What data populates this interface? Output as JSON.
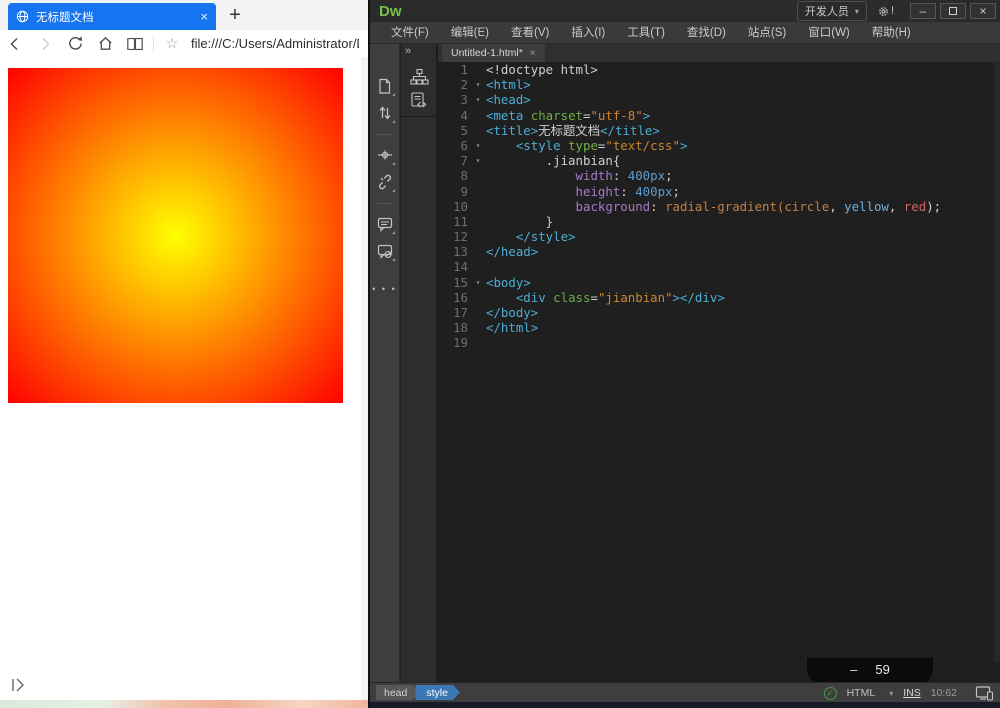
{
  "colors": {
    "browser_tab_blue": "#1574f0",
    "gradient_center": "#ffff00",
    "gradient_edge": "#ff0000",
    "dw_logo_green": "#7cc04b",
    "style_chip_blue": "#3b78b5",
    "check_green": "#43a047"
  },
  "icons": {
    "fold": "▾",
    "caret_down": "▾",
    "check": "✓",
    "star": "☆",
    "ellipsis": "• • •",
    "panel_chevrons": "»"
  },
  "browser": {
    "tab_title": "无标题文档",
    "tab_close": "×",
    "new_tab": "+",
    "address": "file:///C:/Users/Administrator/D"
  },
  "dw": {
    "logo": "Dw",
    "workspace_button": "开发人员",
    "gear_badge": "!",
    "win_minimize": "–",
    "win_close": "×",
    "menus": [
      "文件(F)",
      "编辑(E)",
      "查看(V)",
      "插入(I)",
      "工具(T)",
      "查找(D)",
      "站点(S)",
      "窗口(W)",
      "帮助(H)"
    ],
    "doc_tab": "Untitled-1.html*",
    "doc_tab_close": "×",
    "overlay_fragment_dash": "–",
    "overlay_fragment_text": "59",
    "code_lines": [
      {
        "n": "1",
        "fold": false,
        "seg": [
          {
            "t": "<!doctype html>",
            "c": "plain"
          }
        ]
      },
      {
        "n": "2",
        "fold": true,
        "seg": [
          {
            "t": "<html>",
            "c": "tag"
          }
        ]
      },
      {
        "n": "3",
        "fold": true,
        "seg": [
          {
            "t": "<head>",
            "c": "tag"
          }
        ]
      },
      {
        "n": "4",
        "fold": false,
        "seg": [
          {
            "t": "<meta ",
            "c": "tag"
          },
          {
            "t": "charset",
            "c": "attr"
          },
          {
            "t": "=",
            "c": "plain"
          },
          {
            "t": "\"utf-8\"",
            "c": "string"
          },
          {
            "t": ">",
            "c": "tag"
          }
        ]
      },
      {
        "n": "5",
        "fold": false,
        "seg": [
          {
            "t": "<title>",
            "c": "tag"
          },
          {
            "t": "无标题文档",
            "c": "plain"
          },
          {
            "t": "</title>",
            "c": "tag"
          }
        ]
      },
      {
        "n": "6",
        "fold": true,
        "seg": [
          {
            "t": "    ",
            "c": "plain"
          },
          {
            "t": "<style ",
            "c": "tag"
          },
          {
            "t": "type",
            "c": "attr"
          },
          {
            "t": "=",
            "c": "plain"
          },
          {
            "t": "\"text/css\"",
            "c": "string"
          },
          {
            "t": ">",
            "c": "tag"
          }
        ]
      },
      {
        "n": "7",
        "fold": true,
        "seg": [
          {
            "t": "        .jianbian{",
            "c": "plain"
          }
        ]
      },
      {
        "n": "8",
        "fold": false,
        "seg": [
          {
            "t": "            ",
            "c": "plain"
          },
          {
            "t": "width",
            "c": "prop"
          },
          {
            "t": ": ",
            "c": "plain"
          },
          {
            "t": "400px",
            "c": "num"
          },
          {
            "t": ";",
            "c": "plain"
          }
        ]
      },
      {
        "n": "9",
        "fold": false,
        "seg": [
          {
            "t": "            ",
            "c": "plain"
          },
          {
            "t": "height",
            "c": "prop"
          },
          {
            "t": ": ",
            "c": "plain"
          },
          {
            "t": "400px",
            "c": "num"
          },
          {
            "t": ";",
            "c": "plain"
          }
        ]
      },
      {
        "n": "10",
        "fold": false,
        "seg": [
          {
            "t": "            ",
            "c": "plain"
          },
          {
            "t": "background",
            "c": "prop"
          },
          {
            "t": ": ",
            "c": "plain"
          },
          {
            "t": "radial-gradient(circle",
            "c": "func"
          },
          {
            "t": ", ",
            "c": "plain"
          },
          {
            "t": "yellow",
            "c": "val"
          },
          {
            "t": ", ",
            "c": "plain"
          },
          {
            "t": "red",
            "c": "red"
          },
          {
            "t": ");",
            "c": "plain"
          }
        ]
      },
      {
        "n": "11",
        "fold": false,
        "seg": [
          {
            "t": "        }",
            "c": "plain"
          }
        ]
      },
      {
        "n": "12",
        "fold": false,
        "seg": [
          {
            "t": "    ",
            "c": "plain"
          },
          {
            "t": "</style>",
            "c": "tag"
          }
        ]
      },
      {
        "n": "13",
        "fold": false,
        "seg": [
          {
            "t": "</head>",
            "c": "tag"
          }
        ]
      },
      {
        "n": "14",
        "fold": false,
        "seg": []
      },
      {
        "n": "15",
        "fold": true,
        "seg": [
          {
            "t": "<body>",
            "c": "tag"
          }
        ]
      },
      {
        "n": "16",
        "fold": false,
        "seg": [
          {
            "t": "    ",
            "c": "plain"
          },
          {
            "t": "<div ",
            "c": "tag"
          },
          {
            "t": "class",
            "c": "attr"
          },
          {
            "t": "=",
            "c": "plain"
          },
          {
            "t": "\"jianbian\"",
            "c": "string"
          },
          {
            "t": ">",
            "c": "tag"
          },
          {
            "t": "</div>",
            "c": "tag"
          }
        ]
      },
      {
        "n": "17",
        "fold": false,
        "seg": [
          {
            "t": "</body>",
            "c": "tag"
          }
        ]
      },
      {
        "n": "18",
        "fold": false,
        "seg": [
          {
            "t": "</html>",
            "c": "tag"
          }
        ]
      },
      {
        "n": "19",
        "fold": false,
        "seg": []
      }
    ],
    "status": {
      "tag_head": "head",
      "tag_style": "style",
      "doctype": "HTML",
      "ins": "INS",
      "position": "10:62"
    }
  }
}
